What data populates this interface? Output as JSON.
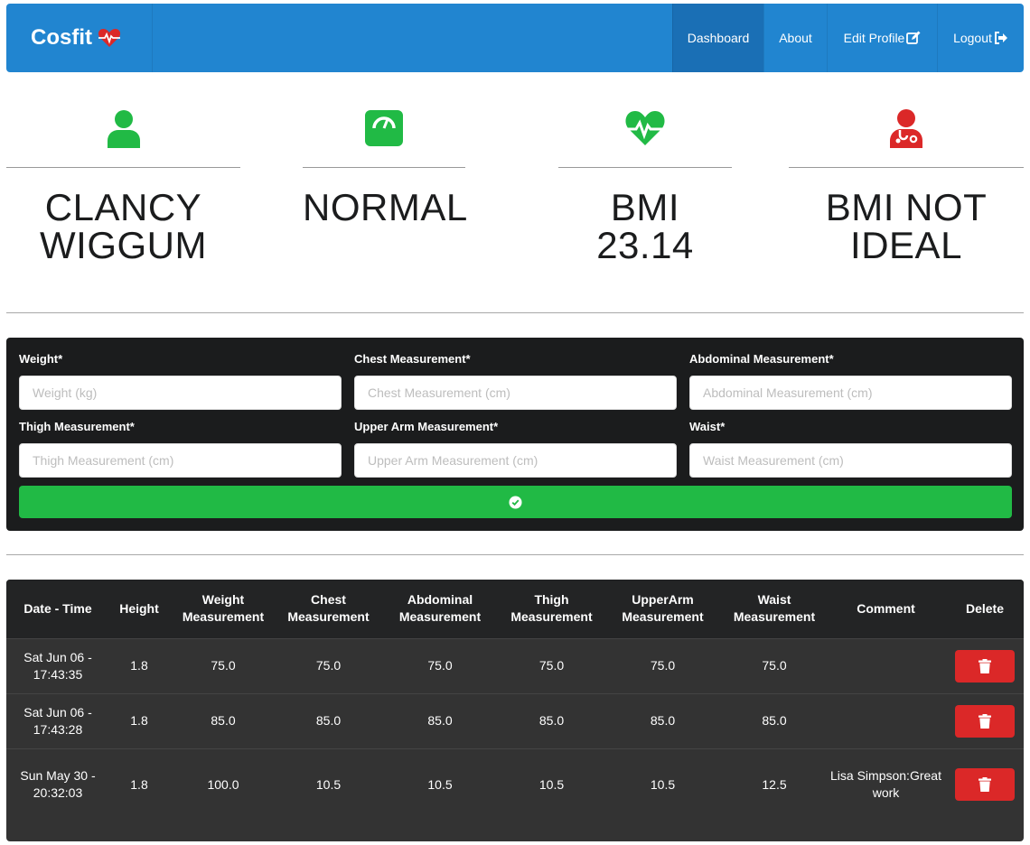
{
  "navbar": {
    "brand": "Cosfit",
    "brand_icon": "heartbeat-icon",
    "accent_color": "#2185d0",
    "items": [
      {
        "label": "Dashboard",
        "active": true
      },
      {
        "label": "About"
      },
      {
        "label": "Edit Profile",
        "icon": "edit-icon"
      },
      {
        "label": "Logout",
        "icon": "sign-out-icon"
      }
    ]
  },
  "stats": [
    {
      "icon": "user-icon",
      "color": "#21ba45",
      "value": "CLANCY WIGGUM"
    },
    {
      "icon": "scale-icon",
      "color": "#21ba45",
      "value": "NORMAL"
    },
    {
      "icon": "heartbeat-icon",
      "color": "#21ba45",
      "value": "BMI 23.14"
    },
    {
      "icon": "doctor-icon",
      "color": "#db2828",
      "value": "BMI NOT IDEAL"
    }
  ],
  "form": {
    "fields": [
      {
        "label": "Weight*",
        "placeholder": "Weight (kg)"
      },
      {
        "label": "Chest Measurement*",
        "placeholder": "Chest Measurement (cm)"
      },
      {
        "label": "Abdominal Measurement*",
        "placeholder": "Abdominal Measurement (cm)"
      },
      {
        "label": "Thigh Measurement*",
        "placeholder": "Thigh Measurement (cm)"
      },
      {
        "label": "Upper Arm Measurement*",
        "placeholder": "Upper Arm Measurement (cm)"
      },
      {
        "label": "Waist*",
        "placeholder": "Waist Measurement (cm)"
      }
    ],
    "submit_icon": "check-circle-icon",
    "submit_color": "#21ba45"
  },
  "table": {
    "headers": [
      "Date - Time",
      "Height",
      "Weight Measurement",
      "Chest Measurement",
      "Abdominal Measurement",
      "Thigh Measurement",
      "UpperArm Measurement",
      "Waist Measurement",
      "Comment",
      "Delete"
    ],
    "rows": [
      {
        "datetime": "Sat Jun 06 - 17:43:35",
        "height": "1.8",
        "weight": "75.0",
        "chest": "75.0",
        "abdominal": "75.0",
        "thigh": "75.0",
        "upperarm": "75.0",
        "waist": "75.0",
        "comment": ""
      },
      {
        "datetime": "Sat Jun 06 - 17:43:28",
        "height": "1.8",
        "weight": "85.0",
        "chest": "85.0",
        "abdominal": "85.0",
        "thigh": "85.0",
        "upperarm": "85.0",
        "waist": "85.0",
        "comment": ""
      },
      {
        "datetime": "Sun May 30 - 20:32:03",
        "height": "1.8",
        "weight": "100.0",
        "chest": "10.5",
        "abdominal": "10.5",
        "thigh": "10.5",
        "upperarm": "10.5",
        "waist": "12.5",
        "comment": "Lisa Simpson:Great work"
      }
    ],
    "delete_icon": "trash-icon",
    "delete_color": "#db2828"
  }
}
